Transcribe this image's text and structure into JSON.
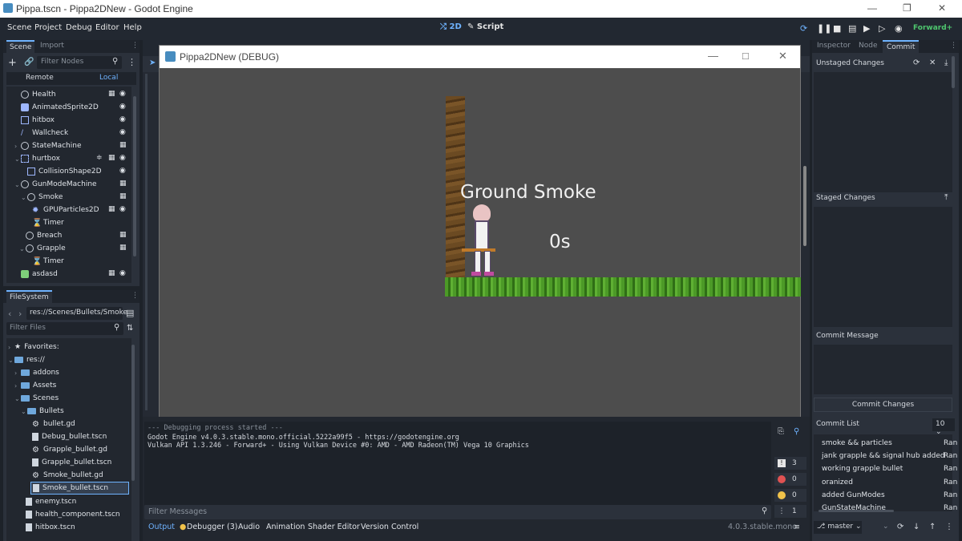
{
  "window": {
    "title": "Pippa.tscn - Pippa2DNew - Godot Engine"
  },
  "menubar": {
    "items": [
      "Scene",
      "Project",
      "Debug",
      "Editor",
      "Help"
    ],
    "workspace_2d": "2D",
    "workspace_script": "Script",
    "renderer": "Forward+"
  },
  "scene_dock": {
    "tabs": [
      "Scene",
      "Import"
    ],
    "filter_placeholder": "Filter Nodes",
    "remote_label": "Remote",
    "local_label": "Local",
    "nodes": [
      {
        "label": "Health"
      },
      {
        "label": "AnimatedSprite2D"
      },
      {
        "label": "hitbox"
      },
      {
        "label": "Wallcheck"
      },
      {
        "label": "StateMachine"
      },
      {
        "label": "hurtbox"
      },
      {
        "label": "CollisionShape2D"
      },
      {
        "label": "GunModeMachine"
      },
      {
        "label": "Smoke"
      },
      {
        "label": "GPUParticles2D"
      },
      {
        "label": "Timer"
      },
      {
        "label": "Breach"
      },
      {
        "label": "Grapple"
      },
      {
        "label": "Timer"
      },
      {
        "label": "asdasd"
      }
    ]
  },
  "filesystem": {
    "tab": "FileSystem",
    "path": "res://Scenes/Bullets/Smoke",
    "filter_placeholder": "Filter Files",
    "items": [
      {
        "label": "Favorites:"
      },
      {
        "label": "res://"
      },
      {
        "label": "addons"
      },
      {
        "label": "Assets"
      },
      {
        "label": "Scenes"
      },
      {
        "label": "Bullets"
      },
      {
        "label": "bullet.gd"
      },
      {
        "label": "Debug_bullet.tscn"
      },
      {
        "label": "Grapple_bullet.gd"
      },
      {
        "label": "Grapple_bullet.tscn"
      },
      {
        "label": "Smoke_bullet.gd"
      },
      {
        "label": "Smoke_bullet.tscn"
      },
      {
        "label": "enemy.tscn"
      },
      {
        "label": "health_component.tscn"
      },
      {
        "label": "hitbox.tscn"
      }
    ]
  },
  "game_window": {
    "title": "Pippa2DNew (DEBUG)",
    "overlay_mode": "Ground Smoke",
    "overlay_timer": "0s"
  },
  "output": {
    "line0": "--- Debugging process started ---",
    "line1": "Godot Engine v4.0.3.stable.mono.official.5222a99f5 - https://godotengine.org",
    "line2": "Vulkan API 1.3.246 - Forward+ - Using Vulkan Device #0: AMD - AMD Radeon(TM) Vega 10 Graphics",
    "filter_placeholder": "Filter Messages",
    "counts": {
      "errors": "3",
      "errors2": "0",
      "warnings": "0",
      "messages": "1"
    }
  },
  "bottom_tabs": [
    "Output",
    "Debugger (3)",
    "Audio",
    "Animation",
    "Shader Editor",
    "Version Control"
  ],
  "version": "4.0.3.stable.mono",
  "right_dock": {
    "tabs": [
      "Inspector",
      "Node",
      "Commit"
    ],
    "unstaged": "Unstaged Changes",
    "staged": "Staged Changes",
    "commit_message": "Commit Message",
    "commit_changes": "Commit Changes",
    "commit_list": "Commit List",
    "commit_count": "10",
    "commits": [
      {
        "msg": "smoke && particles",
        "author": "Ran"
      },
      {
        "msg": "jank grapple && signal hub added",
        "author": "Ran"
      },
      {
        "msg": "working grapple bullet",
        "author": "Ran"
      },
      {
        "msg": "oranized",
        "author": "Ran"
      },
      {
        "msg": "added GunModes",
        "author": "Ran"
      },
      {
        "msg": "GunStateMachine",
        "author": "Ran"
      }
    ],
    "branch": "master"
  },
  "colors": {
    "accent": "#6fb3ff",
    "renderer": "#4ec66e",
    "game_bg": "#4d4d4d",
    "grass": "#3e8a1e"
  }
}
